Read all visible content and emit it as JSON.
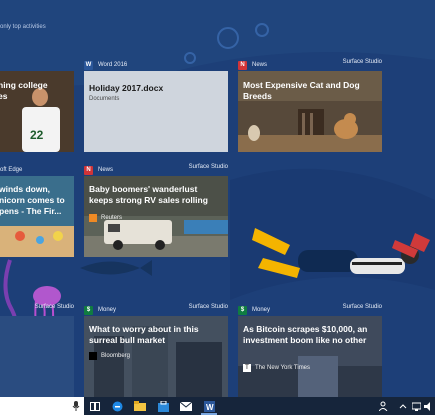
{
  "colors": {
    "desktop": "#1d3f78",
    "taskbar": "#16253b",
    "word": "#2b579a",
    "news": "#d13438",
    "money": "#107c41"
  },
  "timeline": {
    "hint": "only top activities"
  },
  "cards": {
    "partial_left_1": {
      "title_lines": [
        "ning college",
        "es"
      ]
    },
    "word": {
      "app": "Word 2016",
      "app_icon": "word-icon",
      "title": "Holiday 2017.docx",
      "subtitle": "Documents"
    },
    "cats": {
      "app": "News",
      "app_icon": "news-icon",
      "device": "Surface Studio",
      "title": "Most Expensive Cat and Dog Breeds"
    },
    "partial_left_2": {
      "app": "oft Edge",
      "title_lines": [
        "winds down,",
        "nicorn comes to",
        "pens - The Fir..."
      ]
    },
    "boomers": {
      "app": "News",
      "app_icon": "news-icon",
      "device": "Surface Studio",
      "title": "Baby boomers' wanderlust keeps strong RV sales rolling",
      "source": "Reuters"
    },
    "partial_left_3": {
      "device": "Surface Studio"
    },
    "bull": {
      "app": "Money",
      "app_icon": "money-icon",
      "device": "Surface Studio",
      "title": "What to worry about in this surreal bull market",
      "source": "Bloomberg"
    },
    "bitcoin": {
      "app": "Money",
      "app_icon": "money-icon",
      "device": "Surface Studio",
      "title": "As Bitcoin scrapes $10,000, an investment boom like no other",
      "source": "The New York Times"
    }
  },
  "taskbar": {
    "icons": [
      "microphone-icon",
      "task-view-icon",
      "edge-icon",
      "file-explorer-icon",
      "store-icon",
      "mail-icon",
      "word-icon",
      "people-icon",
      "chevron-up-icon",
      "network-icon",
      "volume-icon"
    ]
  }
}
